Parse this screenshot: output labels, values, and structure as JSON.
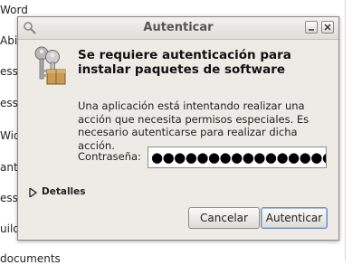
{
  "background": {
    "items": [
      "Word",
      "Abi",
      "ess",
      "ess",
      "Widg",
      "ant p",
      "ess",
      "uild",
      "documents"
    ]
  },
  "dialog": {
    "title": "Autenticar",
    "heading": "Se requiere autenticación para instalar paquetes de software",
    "message": "Una aplicación está intentando realizar una acción que necesita permisos especiales. Es necesario autenticarse para realizar dicha acción.",
    "password_label": "Contraseña:",
    "password_value": "●●●●●●●●●●●●●●●●",
    "details_label": "Detalles",
    "cancel_label": "Cancelar",
    "authenticate_label": "Autenticar"
  },
  "icons": {
    "titlebar": "magnifier-key-icon",
    "main": "keys-icon",
    "minimize": "minimize-icon",
    "close": "close-icon",
    "expander": "expander-arrow-icon"
  },
  "colors": {
    "dialog_bg": "#eeebe7",
    "default_button_border": "#6b8fbf"
  }
}
